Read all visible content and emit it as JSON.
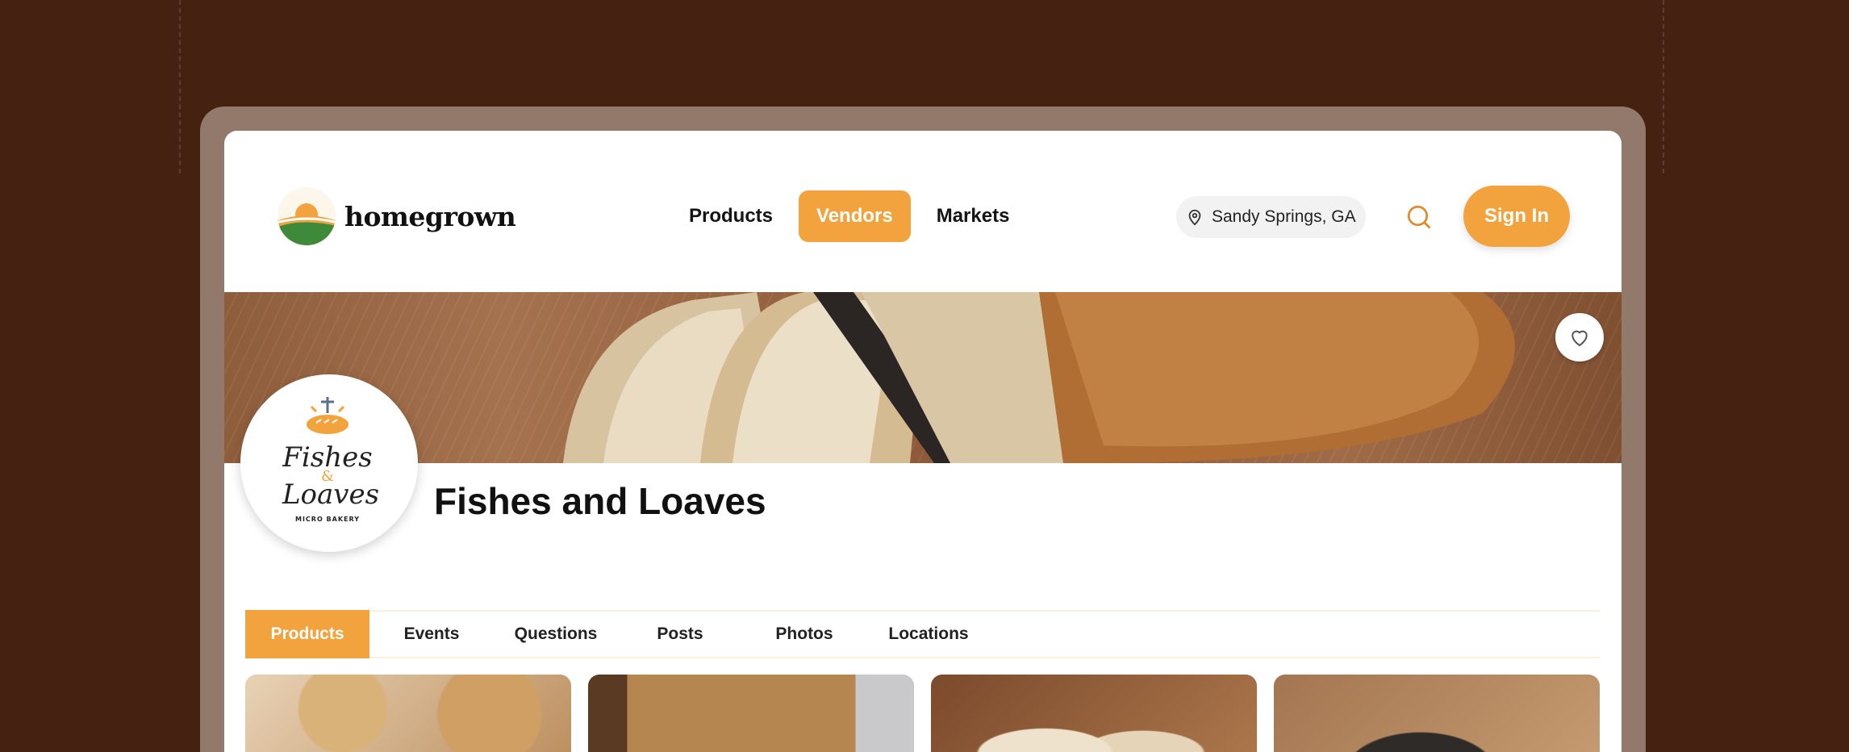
{
  "app": {
    "brand": "homegrown",
    "accent_color": "#f2a33d",
    "background_color": "#452112"
  },
  "nav": {
    "items": [
      {
        "label": "Products",
        "active": false
      },
      {
        "label": "Vendors",
        "active": true
      },
      {
        "label": "Markets",
        "active": false
      }
    ]
  },
  "location": {
    "icon": "map-pin-icon",
    "label": "Sandy Springs, GA"
  },
  "search": {
    "icon": "search-icon"
  },
  "signin": {
    "label": "Sign In"
  },
  "vendor": {
    "name": "Fishes and Loaves",
    "logo": {
      "line1": "Fishes",
      "amp": "&",
      "line2": "Loaves",
      "tagline": "MICRO BAKERY"
    },
    "favorite_icon": "heart-icon"
  },
  "tabs": [
    {
      "label": "Products",
      "active": true
    },
    {
      "label": "Events",
      "active": false
    },
    {
      "label": "Questions",
      "active": false
    },
    {
      "label": "Posts",
      "active": false
    },
    {
      "label": "Photos",
      "active": false
    },
    {
      "label": "Locations",
      "active": false
    }
  ],
  "products": [
    {
      "image": "cookies-photo"
    },
    {
      "image": "jar-and-bread-photo"
    },
    {
      "image": "sliced-bread-photo"
    },
    {
      "image": "poppy-seed-loaf-photo"
    }
  ]
}
